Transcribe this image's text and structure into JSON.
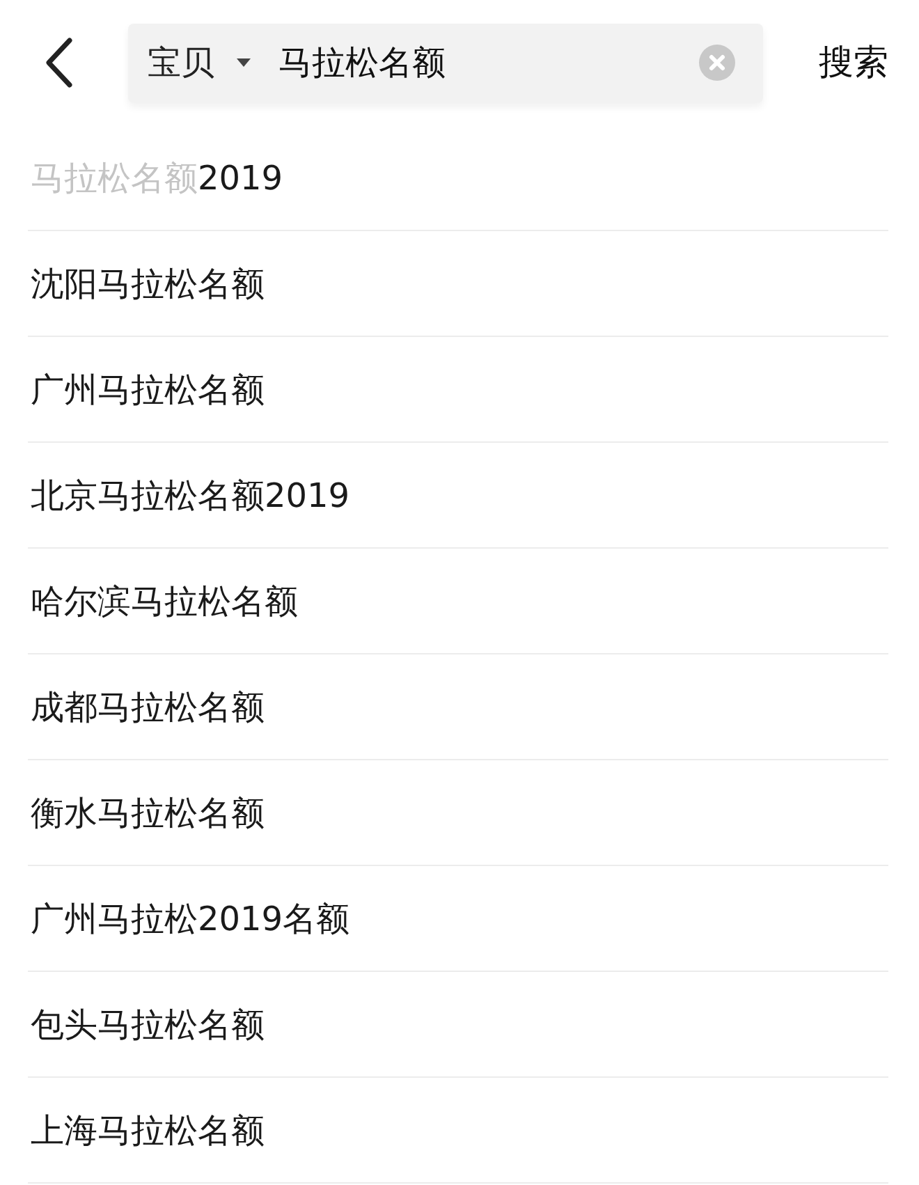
{
  "header": {
    "search": {
      "scope": "宝贝",
      "query": "马拉松名额"
    },
    "action": "搜索"
  },
  "suggestions": [
    {
      "parts": [
        {
          "text": "马拉松名额",
          "muted": true
        },
        {
          "text": "2019",
          "muted": false
        }
      ]
    },
    {
      "parts": [
        {
          "text": "沈阳马拉松名额",
          "muted": false
        }
      ]
    },
    {
      "parts": [
        {
          "text": "广州马拉松名额",
          "muted": false
        }
      ]
    },
    {
      "parts": [
        {
          "text": "北京马拉松名额2019",
          "muted": false
        }
      ]
    },
    {
      "parts": [
        {
          "text": "哈尔滨马拉松名额",
          "muted": false
        }
      ]
    },
    {
      "parts": [
        {
          "text": "成都马拉松名额",
          "muted": false
        }
      ]
    },
    {
      "parts": [
        {
          "text": "衡水马拉松名额",
          "muted": false
        }
      ]
    },
    {
      "parts": [
        {
          "text": "广州马拉松2019名额",
          "muted": false
        }
      ]
    },
    {
      "parts": [
        {
          "text": "包头马拉松名额",
          "muted": false
        }
      ]
    },
    {
      "parts": [
        {
          "text": "上海马拉松名额",
          "muted": false
        }
      ]
    }
  ]
}
